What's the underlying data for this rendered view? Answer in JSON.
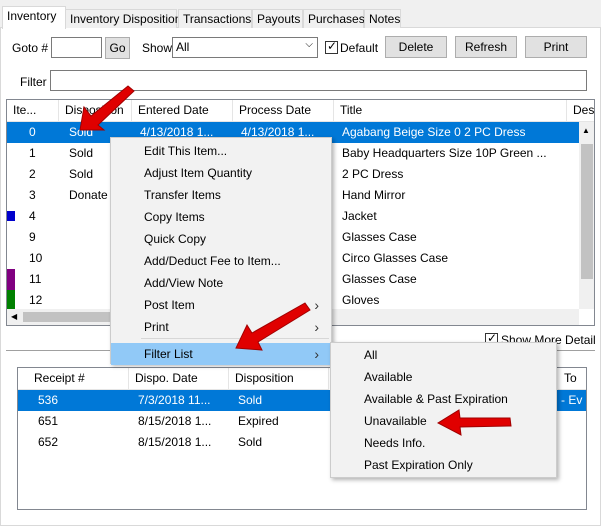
{
  "tabs": [
    "Inventory",
    "Inventory Disposition",
    "Transactions",
    "Payouts",
    "Purchases",
    "Notes"
  ],
  "toolbar": {
    "goto_label": "Goto #",
    "go_label": "Go",
    "show_label": "Show",
    "show_value": "All",
    "default_label": "Default",
    "delete_label": "Delete",
    "refresh_label": "Refresh",
    "print_label": "Print",
    "filter_label": "Filter"
  },
  "inventory_grid": {
    "columns": [
      "Ite...",
      "Disposition",
      "Entered Date",
      "Process Date",
      "Title",
      "Des"
    ],
    "rows": [
      {
        "item": "0",
        "disposition": "Sold",
        "entered": "4/13/2018 1...",
        "process": "4/13/2018 1...",
        "title": "Agabang Beige Size 0 2 PC Dress",
        "selected": true
      },
      {
        "item": "1",
        "disposition": "Sold",
        "entered": "",
        "process": "",
        "title": "Baby Headquarters Size 10P Green ..."
      },
      {
        "item": "2",
        "disposition": "Sold",
        "entered": "",
        "process": "",
        "title": "2 PC Dress"
      },
      {
        "item": "3",
        "disposition": "Donate",
        "entered": "",
        "process": "",
        "title": "Hand Mirror"
      },
      {
        "item": "4",
        "disposition": "",
        "entered": "",
        "process": "",
        "title": "Jacket",
        "color": "#0000cc"
      },
      {
        "item": "9",
        "disposition": "",
        "entered": "",
        "process": "",
        "title": "Glasses Case"
      },
      {
        "item": "10",
        "disposition": "",
        "entered": "",
        "process": "",
        "title": "Circo Glasses Case"
      },
      {
        "item": "11",
        "disposition": "",
        "entered": "",
        "process": "",
        "title": "Glasses Case",
        "color": "#800080"
      },
      {
        "item": "12",
        "disposition": "",
        "entered": "",
        "process": "",
        "title": "Gloves",
        "color": "#008000"
      }
    ]
  },
  "show_more_detail_label": "Show More Detail",
  "receipt_grid": {
    "columns": [
      "Receipt #",
      "Dispo. Date",
      "Disposition",
      "To"
    ],
    "rows": [
      {
        "receipt": "536",
        "date": "7/3/2018 11...",
        "disposition": "Sold",
        "to": "- Ev",
        "selected": true
      },
      {
        "receipt": "651",
        "date": "8/15/2018 1...",
        "disposition": "Expired",
        "to": ""
      },
      {
        "receipt": "652",
        "date": "8/15/2018 1...",
        "disposition": "Sold",
        "to": ""
      }
    ]
  },
  "context_menu": {
    "items": [
      {
        "label": "Edit This Item...",
        "submenu": false
      },
      {
        "label": "Adjust Item Quantity",
        "submenu": false
      },
      {
        "label": "Transfer Items",
        "submenu": false
      },
      {
        "label": "Copy Items",
        "submenu": false
      },
      {
        "label": "Quick Copy",
        "submenu": false
      },
      {
        "label": "Add/Deduct Fee to Item...",
        "submenu": false
      },
      {
        "label": "Add/View Note",
        "submenu": false
      },
      {
        "label": "Post Item",
        "submenu": true
      },
      {
        "label": "Print",
        "submenu": true
      },
      {
        "label": "Filter List",
        "submenu": true,
        "highlighted": true
      }
    ]
  },
  "filter_submenu": {
    "items": [
      "All",
      "Available",
      "Available & Past Expiration",
      "Unavailable",
      "Needs Info.",
      "Past Expiration Only"
    ]
  },
  "colors": {
    "selection": "#0078d7",
    "menu_highlight": "#91c9f7",
    "annotation_arrow": "#e00000"
  }
}
